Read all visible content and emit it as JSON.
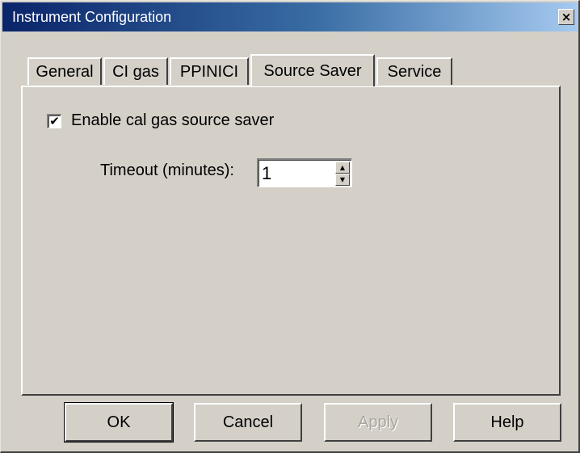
{
  "window": {
    "title": "Instrument Configuration",
    "close_glyph": "×"
  },
  "tabs": [
    {
      "label": "General",
      "active": false
    },
    {
      "label": "CI gas",
      "active": false
    },
    {
      "label": "PPINICI",
      "active": false
    },
    {
      "label": "Source Saver",
      "active": true
    },
    {
      "label": "Service",
      "active": false
    }
  ],
  "source_saver": {
    "enable_checkbox": {
      "label": "Enable cal gas source saver",
      "checked": true,
      "check_glyph": "✔"
    },
    "timeout": {
      "label": "Timeout (minutes):",
      "value": "1",
      "up_glyph": "▲",
      "down_glyph": "▼"
    }
  },
  "buttons": {
    "ok": "OK",
    "cancel": "Cancel",
    "apply": "Apply",
    "help": "Help"
  },
  "colors": {
    "face": "#d4d0c8",
    "title_start": "#0a246a",
    "title_end": "#a6caf0",
    "disabled_text": "#a8a69f"
  }
}
